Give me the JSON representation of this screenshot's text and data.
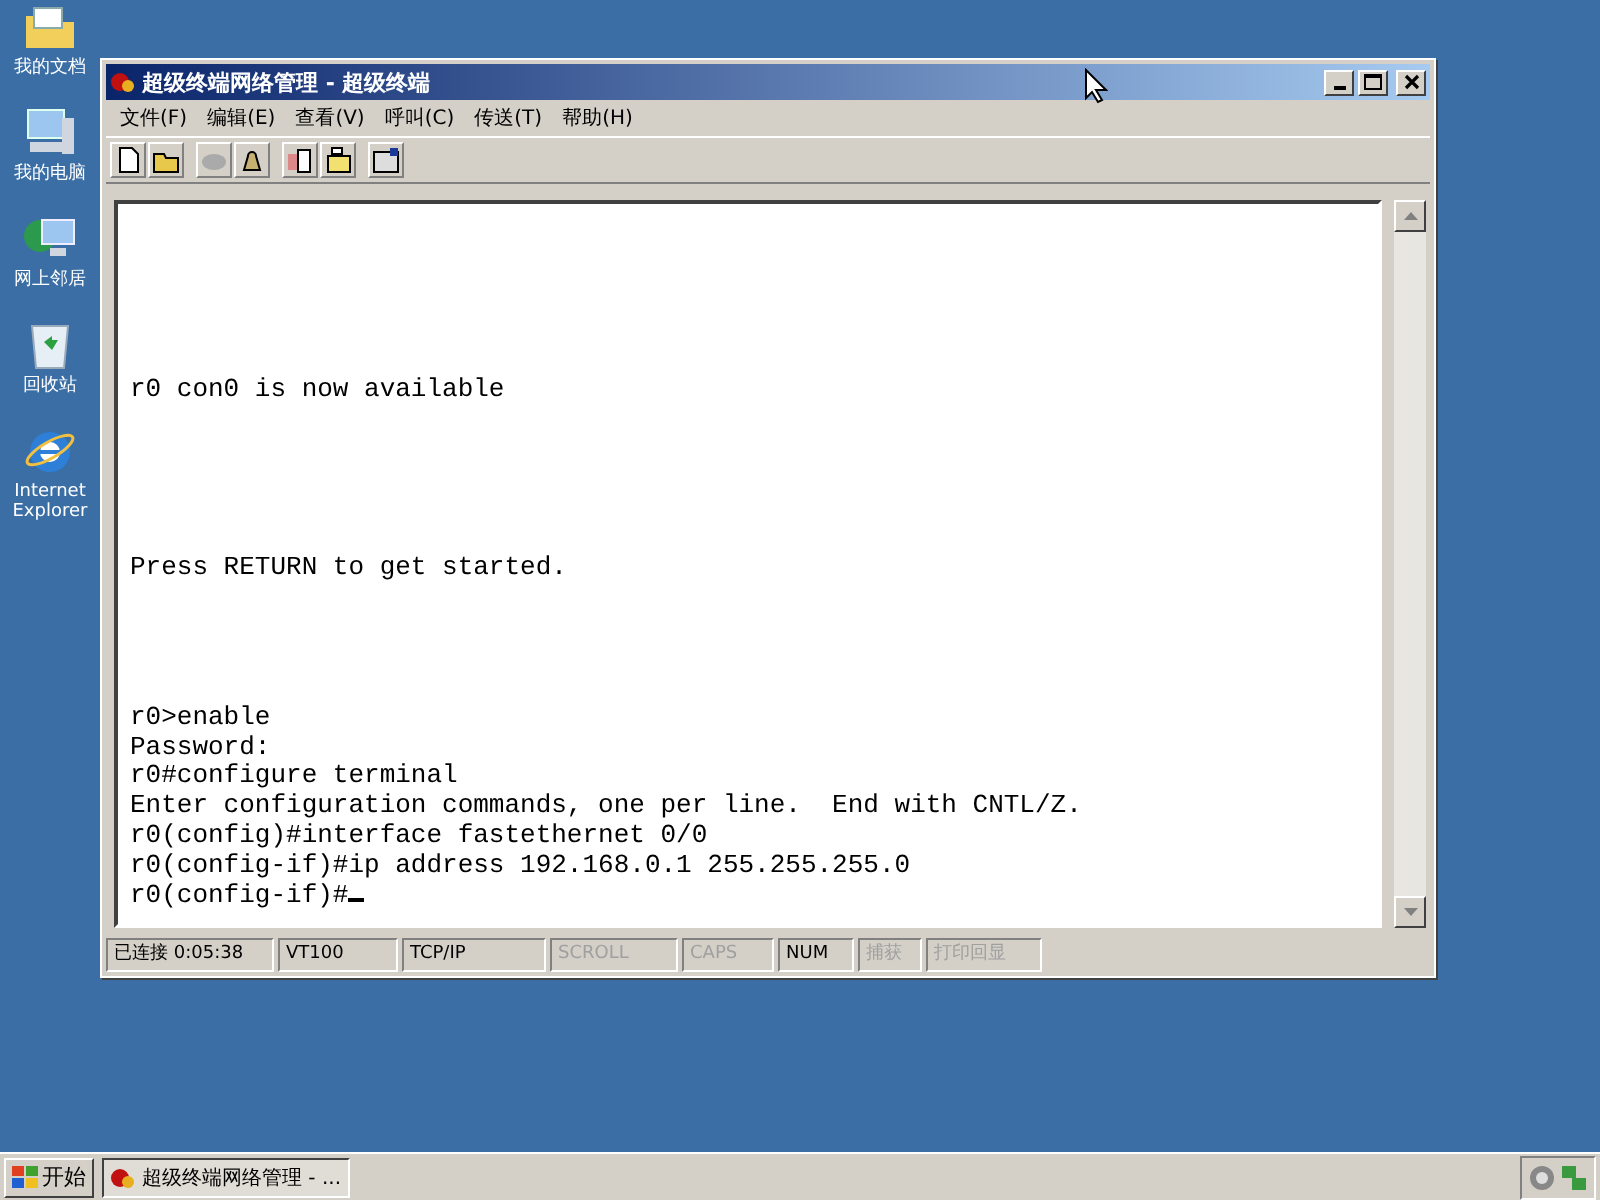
{
  "desktop_icons": [
    {
      "label": "我的文档",
      "kind": "folder"
    },
    {
      "label": "我的电脑",
      "kind": "computer"
    },
    {
      "label": "网上邻居",
      "kind": "network"
    },
    {
      "label": "回收站",
      "kind": "bin"
    },
    {
      "label": "Internet Explorer",
      "kind": "ie"
    }
  ],
  "window": {
    "title": "超级终端网络管理 - 超级终端"
  },
  "menu": [
    "文件(F)",
    "编辑(E)",
    "查看(V)",
    "呼叫(C)",
    "传送(T)",
    "帮助(H)"
  ],
  "terminal": {
    "text": "r0 con0 is now available\n\n\n\n\n\nPress RETURN to get started.\n\n\n\n\nr0>enable\nPassword:\nr0#configure terminal\nEnter configuration commands, one per line.  End with CNTL/Z.\nr0(config)#interface fastethernet 0/0\nr0(config-if)#ip address 192.168.0.1 255.255.255.0\nr0(config-if)#"
  },
  "status_bar": [
    {
      "text": "已连接 0:05:38",
      "disabled": false
    },
    {
      "text": "VT100",
      "disabled": false
    },
    {
      "text": "TCP/IP",
      "disabled": false
    },
    {
      "text": "SCROLL",
      "disabled": true
    },
    {
      "text": "CAPS",
      "disabled": true
    },
    {
      "text": "NUM",
      "disabled": false
    },
    {
      "text": "捕获",
      "disabled": true
    },
    {
      "text": "打印回显",
      "disabled": true
    }
  ],
  "taskbar": {
    "start": "开始",
    "task": "超级终端网络管理 - ..."
  }
}
